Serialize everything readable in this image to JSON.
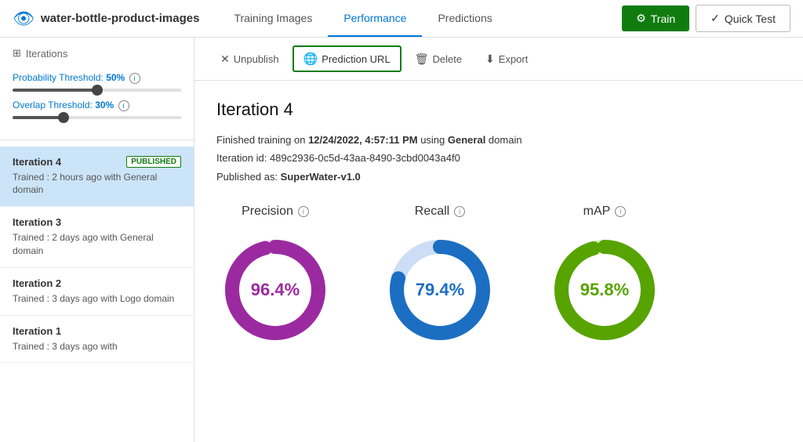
{
  "app": {
    "logo_icon": "👁",
    "title": "water-bottle-product-images"
  },
  "nav": {
    "items": [
      {
        "label": "Training Images",
        "active": false
      },
      {
        "label": "Performance",
        "active": true
      },
      {
        "label": "Predictions",
        "active": false
      }
    ]
  },
  "header": {
    "train_label": "Train",
    "quick_test_label": "Quick Test"
  },
  "sidebar": {
    "title": "Iterations",
    "probability_threshold_label": "Probability Threshold:",
    "probability_threshold_value": "50%",
    "overlap_threshold_label": "Overlap Threshold:",
    "overlap_threshold_value": "30%",
    "iterations": [
      {
        "id": 4,
        "name": "Iteration 4",
        "published": true,
        "published_label": "PUBLISHED",
        "description": "Trained : 2 hours ago with General domain",
        "active": true
      },
      {
        "id": 3,
        "name": "Iteration 3",
        "published": false,
        "published_label": "",
        "description": "Trained : 2 days ago with General domain",
        "active": false
      },
      {
        "id": 2,
        "name": "Iteration 2",
        "published": false,
        "published_label": "",
        "description": "Trained : 3 days ago with Logo domain",
        "active": false
      },
      {
        "id": 1,
        "name": "Iteration 1",
        "published": false,
        "published_label": "",
        "description": "Trained : 3 days ago with",
        "active": false
      }
    ]
  },
  "toolbar": {
    "unpublish_label": "Unpublish",
    "prediction_url_label": "Prediction URL",
    "delete_label": "Delete",
    "export_label": "Export"
  },
  "iteration_detail": {
    "heading": "Iteration 4",
    "meta_line1_prefix": "Finished training on ",
    "meta_line1_date": "12/24/2022, 4:57:11 PM",
    "meta_line1_suffix": " using ",
    "meta_line1_domain": "General",
    "meta_line1_domain_suffix": " domain",
    "meta_line2_prefix": "Iteration id: ",
    "meta_line2_id": "489c2936-0c5d-43aa-8490-3cbd0043a4f0",
    "meta_line3_prefix": "Published as: ",
    "meta_line3_name": "SuperWater-v1.0"
  },
  "metrics": {
    "precision": {
      "label": "Precision",
      "value": "96.4%",
      "percent": 96.4,
      "color": "#9b2aa0",
      "track_color": "#e8d0e8"
    },
    "recall": {
      "label": "Recall",
      "value": "79.4%",
      "percent": 79.4,
      "color": "#1b6ec2",
      "track_color": "#ccddf5"
    },
    "map": {
      "label": "mAP",
      "value": "95.8%",
      "percent": 95.8,
      "color": "#57a300",
      "track_color": "#d8edbb"
    }
  }
}
